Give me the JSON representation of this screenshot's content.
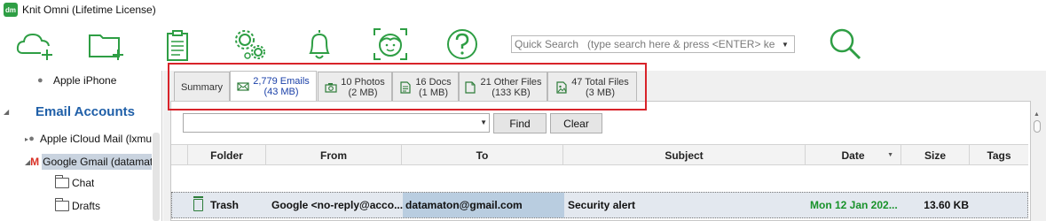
{
  "window": {
    "title": "Knit Omni (Lifetime License)",
    "logo_text": "dm"
  },
  "toolbar": {
    "icons": [
      "cloud-add-icon",
      "folder-add-icon",
      "clipboard-report-icon",
      "settings-gears-icon",
      "notification-bell-icon",
      "face-scan-icon",
      "help-icon",
      "search-icon"
    ],
    "accent_color": "#2e9e44",
    "search_placeholder": "Quick Search   (type search here & press <ENTER> key)"
  },
  "tree": {
    "items": [
      {
        "label": "Apple iPhone",
        "icon": "apple-icon"
      },
      {
        "label": "Email Accounts"
      },
      {
        "label": "Apple iCloud Mail (lxmu",
        "icon": "apple-icon"
      },
      {
        "label": "Google Gmail (datamat",
        "icon": "gmail-icon",
        "selected": true
      },
      {
        "label": "Chat",
        "icon": "folder-icon"
      },
      {
        "label": "Drafts",
        "icon": "folder-icon"
      }
    ]
  },
  "tabs": [
    {
      "label": "Summary"
    },
    {
      "label": "2,779 Emails",
      "sub": "(43 MB)",
      "active": true,
      "icon": "envelope-icon"
    },
    {
      "label": "10 Photos",
      "sub": "(2 MB)",
      "icon": "camera-icon"
    },
    {
      "label": "16 Docs",
      "sub": "(1 MB)",
      "icon": "document-icon"
    },
    {
      "label": "21 Other Files",
      "sub": "(133 KB)",
      "icon": "file-icon"
    },
    {
      "label": "47 Total Files",
      "sub": "(3 MB)",
      "icon": "image-file-icon"
    }
  ],
  "filter": {
    "value": "",
    "find_label": "Find",
    "clear_label": "Clear"
  },
  "grid": {
    "columns": [
      "Folder",
      "From",
      "To",
      "Subject",
      "Date",
      "Size",
      "Tags"
    ],
    "rows": [
      {
        "folder": "Trash",
        "from": "Google <no-reply@acco...",
        "to": "datamaton@gmail.com",
        "subject": "Security alert",
        "date": "Mon 12 Jan 202...",
        "size": "13.60 KB",
        "tags": ""
      }
    ]
  }
}
